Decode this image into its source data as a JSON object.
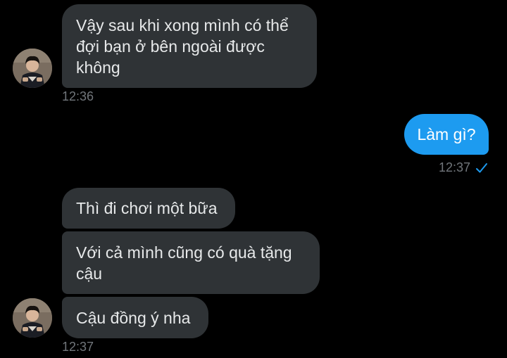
{
  "colors": {
    "background": "#000000",
    "incoming_bubble": "#2f3336",
    "outgoing_bubble": "#1d9bf0",
    "timestamp": "#71767b",
    "check": "#1d9bf0"
  },
  "messages": {
    "m1": {
      "line1": "Vậy sau khi xong mình có thể",
      "line2": "đợi bạn ở bên ngoài được",
      "line3": "không",
      "time": "12:36"
    },
    "m2": {
      "text": "Làm gì?",
      "time": "12:37",
      "status_icon": "check-icon"
    },
    "m3": {
      "text": "Thì đi chơi một bữa"
    },
    "m4": {
      "line1": "Với cả mình cũng có quà tặng",
      "line2": "cậu"
    },
    "m5": {
      "text": "Cậu đồng ý nha",
      "time": "12:37"
    }
  },
  "avatars": {
    "icon": "user-avatar-photo"
  }
}
